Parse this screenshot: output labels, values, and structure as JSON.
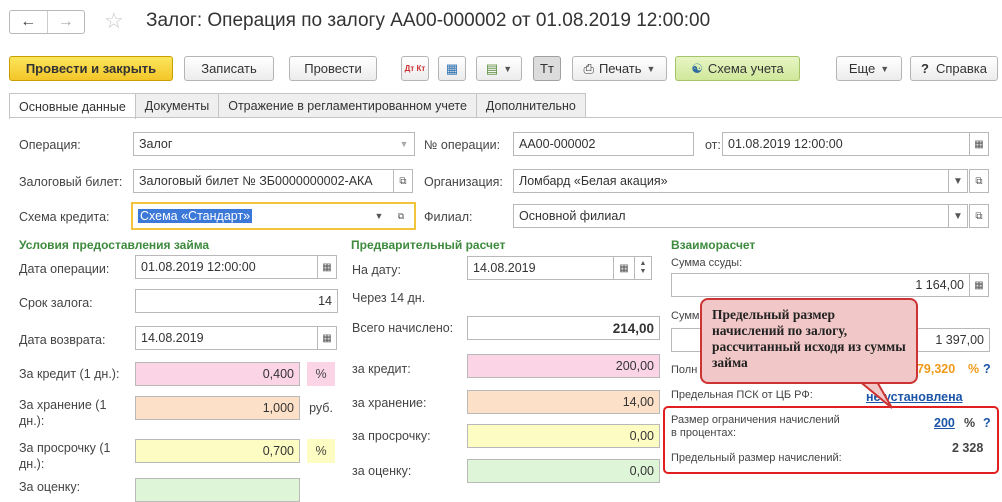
{
  "window": {
    "title": "Залог: Операция по залогу АА00-000002 от 01.08.2019 12:00:00"
  },
  "toolbar": {
    "post_close": "Провести и закрыть",
    "save": "Записать",
    "post": "Провести",
    "dtkt": "Дт Кт",
    "print": "Печать",
    "scheme": "Схема учета",
    "more": "Еще",
    "help": "Справка",
    "font_btn": "Тт"
  },
  "tabs": [
    "Основные данные",
    "Документы",
    "Отражение в регламентированном учете",
    "Дополнительно"
  ],
  "header": {
    "operation_label": "Операция:",
    "operation_value": "Залог",
    "ticket_label": "Залоговый билет:",
    "ticket_value": "Залоговый билет № ЗБ0000000002-АКА",
    "scheme_label": "Схема кредита:",
    "scheme_value": "Схема «Стандарт»",
    "number_label": "№ операции:",
    "number_value": "АА00-000002",
    "from_label": "от:",
    "from_value": "01.08.2019 12:00:00",
    "org_label": "Организация:",
    "org_value": "Ломбард «Белая акация»",
    "branch_label": "Филиал:",
    "branch_value": "Основной филиал"
  },
  "terms": {
    "title": "Условия предоставления займа",
    "op_date_label": "Дата операции:",
    "op_date_value": "01.08.2019 12:00:00",
    "term_label": "Срок залога:",
    "term_value": "14",
    "return_label": "Дата возврата:",
    "return_value": "14.08.2019",
    "credit_label": "За кредит (1 дн.):",
    "credit_value": "0,400",
    "credit_unit": "%",
    "storage_label1": "За хранение (1",
    "storage_label2": "дн.):",
    "storage_value": "1,000",
    "storage_unit": "руб.",
    "overdue_label1": "За просрочку (1",
    "overdue_label2": "дн.):",
    "overdue_value": "0,700",
    "overdue_unit": "%",
    "cut_label": "За оценку:"
  },
  "calc": {
    "title": "Предварительный расчет",
    "date_label": "На дату:",
    "date_value": "14.08.2019",
    "days_text": "Через 14 дн.",
    "total_label": "Всего начислено:",
    "total_value": "214,00",
    "credit_label": "за кредит:",
    "credit_value": "200,00",
    "storage_label": "за хранение:",
    "storage_value": "14,00",
    "overdue_label": "за просрочку:",
    "overdue_value": "0,00",
    "appraisal_label": "за оценку:",
    "appraisal_value": "0,00"
  },
  "settle": {
    "title": "Взаиморасчет",
    "loan_label": "Сумма ссуды:",
    "loan_value": "1 164,00",
    "sum_label_part": "Сумм",
    "sum_value": "1 397,00",
    "full_label_part": "Полн",
    "full_value": "479,320",
    "full_unit": "%",
    "psk_label": "Предельная ПСК от ЦБ РФ:",
    "psk_value": "не установлена",
    "limit_label1": "Размер ограничения начислений",
    "limit_label2": "в процентах:",
    "limit_value": "200",
    "limit_unit": "%",
    "max_label": "Предельный размер начислений:",
    "max_value": "2 328",
    "q": "?"
  },
  "callout": {
    "text": "Предельный размер начислений по залогу, рассчитанный исходя из суммы займа"
  }
}
